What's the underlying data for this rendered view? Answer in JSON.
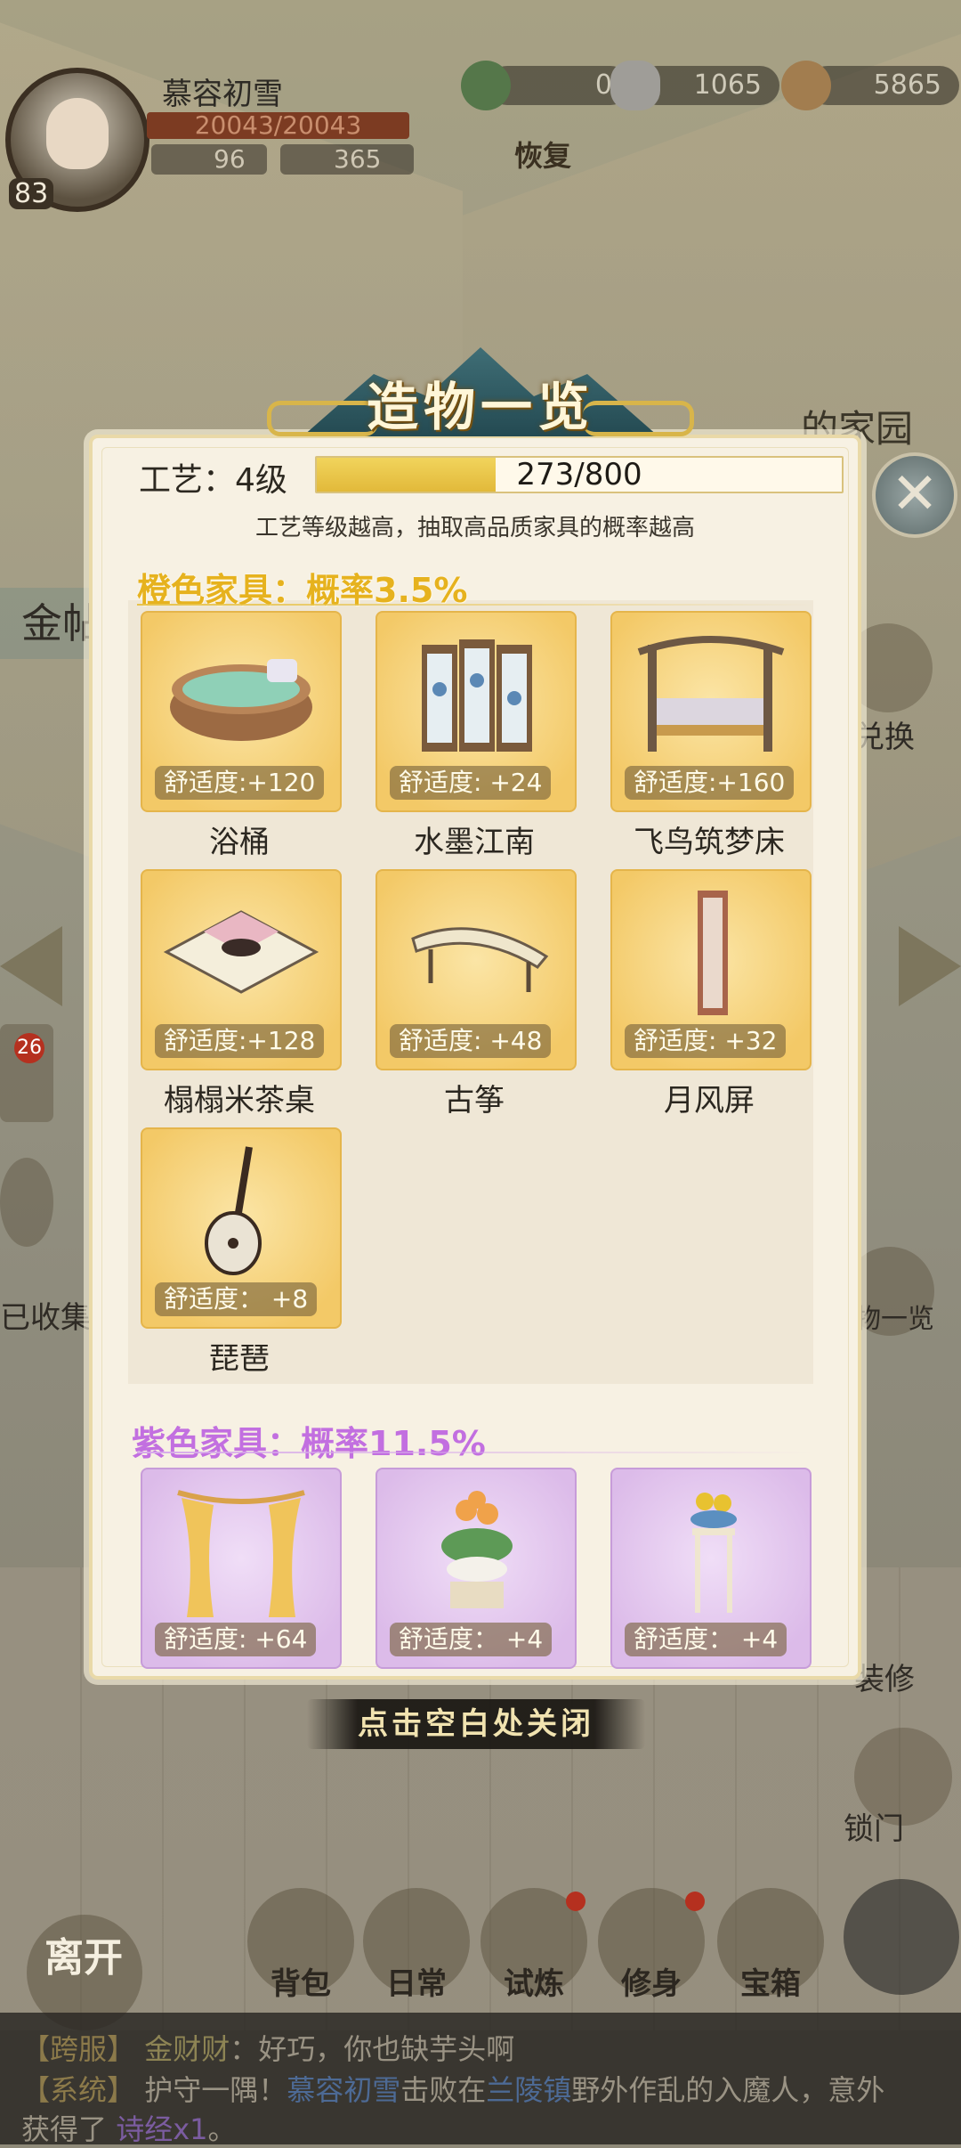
{
  "player": {
    "name": "慕容初雪",
    "hp": "20043/20043",
    "level": "83",
    "stat_a": "96",
    "stat_b": "365",
    "restore_label": "恢复"
  },
  "resources": [
    {
      "icon": "jade-dragon-icon",
      "value": "0"
    },
    {
      "icon": "silver-ingot-icon",
      "value": "1065"
    },
    {
      "icon": "copper-coins-icon",
      "value": "5865"
    }
  ],
  "background": {
    "home_label": "的家园",
    "left_tab": "金帖",
    "collected_label": "已收集",
    "exchange_label": "兑换",
    "overview_label": "造物一览",
    "repair_label": "装修",
    "lock_label": "锁门",
    "badge_count": "26"
  },
  "modal": {
    "title": "造物一览",
    "craft_label": "工艺：4级",
    "craft_progress_text": "273/800",
    "craft_progress_fraction": 0.34,
    "craft_hint": "工艺等级越高，抽取高品质家具的概率越高",
    "close_hint": "点击空白处关闭",
    "orange_section": {
      "title": "橙色家具：概率3.5%",
      "items": [
        {
          "name": "浴桶",
          "comfort": "舒适度:+120"
        },
        {
          "name": "水墨江南",
          "comfort": "舒适度: +24"
        },
        {
          "name": "飞鸟筑梦床",
          "comfort": "舒适度:+160"
        },
        {
          "name": "榻榻米茶桌",
          "comfort": "舒适度:+128"
        },
        {
          "name": "古筝",
          "comfort": "舒适度: +48"
        },
        {
          "name": "月风屏",
          "comfort": "舒适度: +32"
        },
        {
          "name": "琵琶",
          "comfort": "舒适度： +8"
        }
      ]
    },
    "purple_section": {
      "title": "紫色家具：概率11.5%",
      "items": [
        {
          "comfort": "舒适度: +64"
        },
        {
          "comfort": "舒适度： +4"
        },
        {
          "comfort": "舒适度： +4"
        }
      ]
    }
  },
  "bottom_nav": [
    {
      "label": "离开"
    },
    {
      "label": "背包"
    },
    {
      "label": "日常"
    },
    {
      "label": "试炼"
    },
    {
      "label": "修身"
    },
    {
      "label": "宝箱"
    }
  ],
  "chat": {
    "line1_tag": "【跨服】",
    "line1_name": "金财财",
    "line1_text": "：好巧，你也缺芋头啊",
    "line2_tag": "【系统】",
    "line2_pre": "护守一隅！",
    "line2_player": "慕容初雪",
    "line2_mid": "击败在",
    "line2_place": "兰陵镇",
    "line2_post": "野外作乱的入魔人，意外",
    "line3_pre": "获得了",
    "line3_item": "诗经x1",
    "line3_post": "。"
  }
}
